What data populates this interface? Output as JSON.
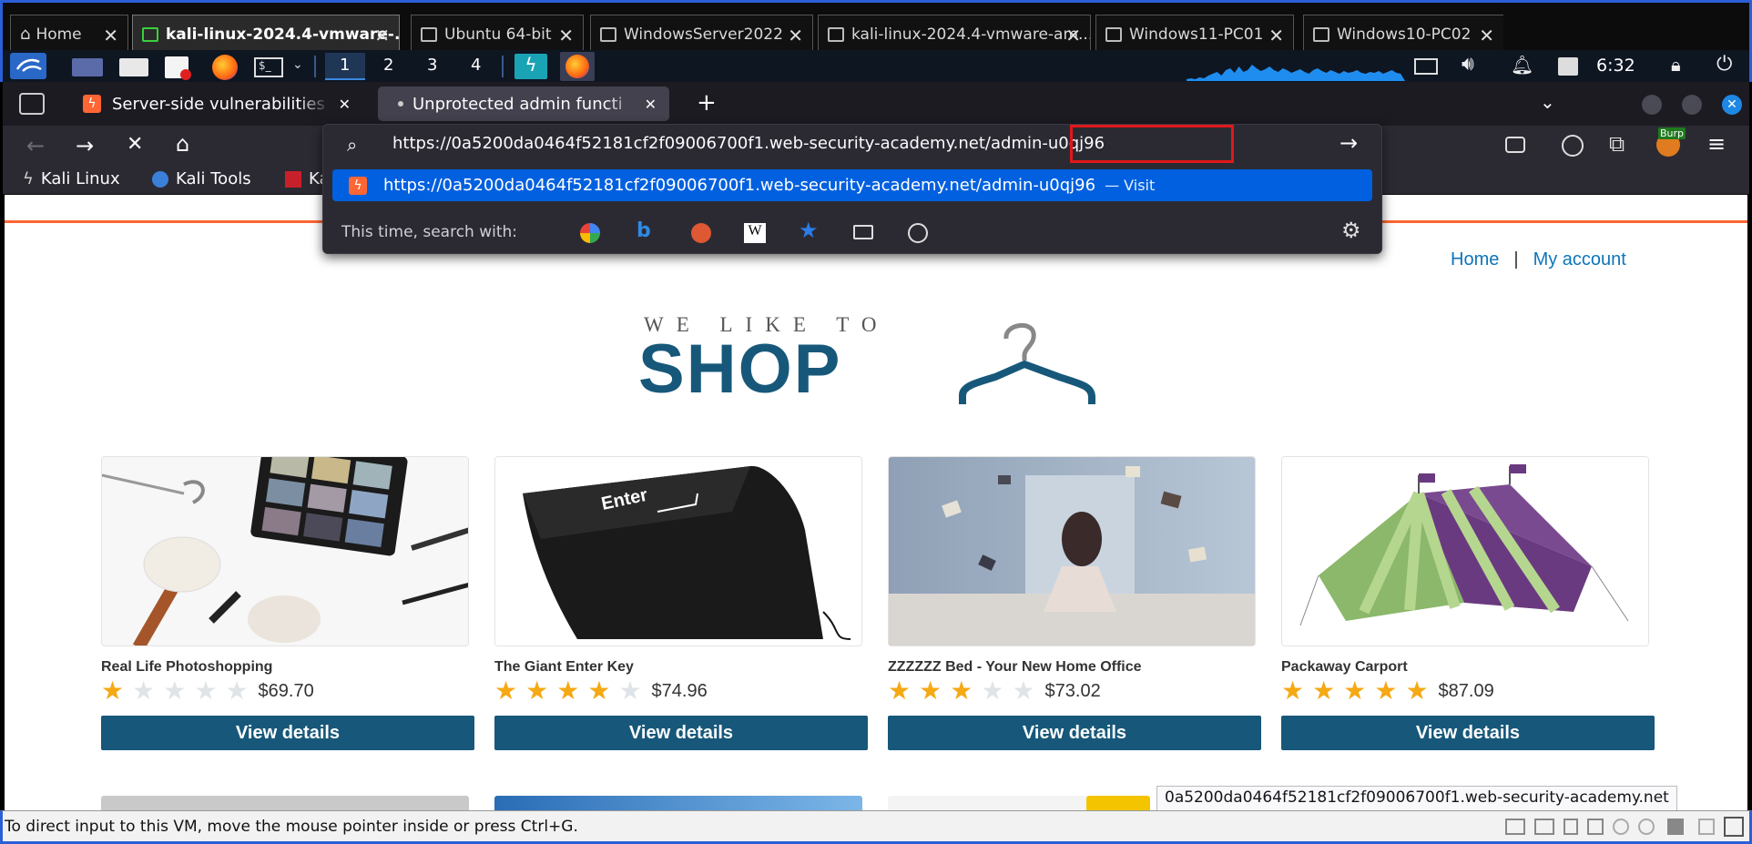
{
  "vm_tabs": [
    {
      "label": "Home"
    },
    {
      "label": "kali-linux-2024.4-vmware-..."
    },
    {
      "label": "Ubuntu 64-bit"
    },
    {
      "label": "WindowsServer2022"
    },
    {
      "label": "kali-linux-2024.4-vmware-am..."
    },
    {
      "label": "Windows11-PC01"
    },
    {
      "label": "Windows10-PC02"
    }
  ],
  "panel": {
    "workspaces": [
      "1",
      "2",
      "3",
      "4"
    ],
    "clock": "6:32"
  },
  "browser_tabs": [
    {
      "title": "Server-side vulnerabilities"
    },
    {
      "title": "Unprotected admin functi"
    }
  ],
  "url": {
    "base": "https://0a5200da0464f52181cf2f09006700f1.web-security-academy.net/",
    "path": "admin-u0qj96"
  },
  "suggestion": {
    "url": "https://0a5200da0464f52181cf2f09006700f1.web-security-academy.net/admin-u0qj96",
    "action": "— Visit"
  },
  "search_with": "This time, search with:",
  "bookmarks": [
    "Kali Linux",
    "Kali Tools",
    "Ka"
  ],
  "extension_badge": "Burp",
  "site": {
    "nav": {
      "home": "Home",
      "separator": "|",
      "account": "My account"
    },
    "logo": {
      "tagline": "WE LIKE TO",
      "word": "SHOP"
    },
    "products": [
      {
        "name": "Real Life Photoshopping",
        "rating": 1,
        "price": "$69.70",
        "button": "View details"
      },
      {
        "name": "The Giant Enter Key",
        "rating": 4,
        "price": "$74.96",
        "button": "View details",
        "image_text": "Enter"
      },
      {
        "name": "ZZZZZZ Bed - Your New Home Office",
        "rating": 3,
        "price": "$73.02",
        "button": "View details"
      },
      {
        "name": "Packaway Carport",
        "rating": 5,
        "price": "$87.09",
        "button": "View details"
      }
    ]
  },
  "link_preview": "0a5200da0464f52181cf2f09006700f1.web-security-academy.net",
  "vm_status": "To direct input to this VM, move the mouse pointer inside or press Ctrl+G.",
  "colors": {
    "accent": "#2b5fd8",
    "site_button": "#17587a",
    "site_link": "#0d75b9",
    "star": "#f4a915",
    "firefox_highlight": "#0060df",
    "red_annotation": "#e0181b"
  }
}
